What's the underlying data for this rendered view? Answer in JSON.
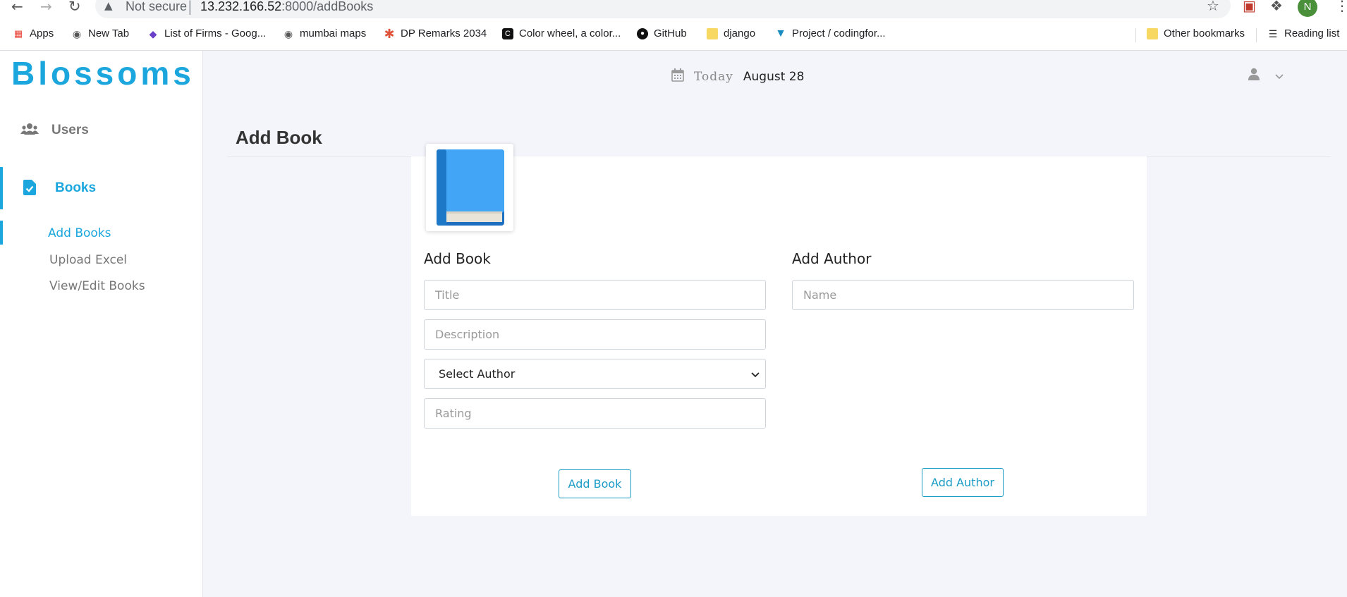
{
  "browser": {
    "security_label": "Not secure",
    "url_host": "13.232.166.52",
    "url_rest": ":8000/addBooks",
    "profile_initial": "N",
    "bookmarks": [
      {
        "label": "Apps",
        "icon": "apps-grid-icon"
      },
      {
        "label": "New Tab",
        "icon": "globe-icon"
      },
      {
        "label": "List of Firms - Goog...",
        "icon": "stack-icon"
      },
      {
        "label": "mumbai maps",
        "icon": "globe-icon"
      },
      {
        "label": "DP Remarks 2034",
        "icon": "asterisk-icon"
      },
      {
        "label": "Color wheel, a color...",
        "icon": "color-wheel-icon"
      },
      {
        "label": "GitHub",
        "icon": "github-icon"
      },
      {
        "label": "django",
        "icon": "folder-icon"
      },
      {
        "label": "Project / codingfor...",
        "icon": "fox-icon"
      }
    ],
    "other_bookmarks": "Other bookmarks",
    "reading_list": "Reading list"
  },
  "sidebar": {
    "brand": "Blossoms",
    "items": [
      {
        "label": "Users",
        "icon": "users-icon"
      },
      {
        "label": "Books",
        "icon": "file-check-icon"
      }
    ],
    "sub_items": [
      {
        "label": "Add Books"
      },
      {
        "label": "Upload Excel"
      },
      {
        "label": "View/Edit Books"
      }
    ]
  },
  "topbar": {
    "today_label": "Today",
    "date": "August 28"
  },
  "page": {
    "title": "Add Book",
    "book_form": {
      "heading": "Add Book",
      "title_placeholder": "Title",
      "description_placeholder": "Description",
      "author_select": "Select Author",
      "rating_placeholder": "Rating",
      "submit": "Add Book"
    },
    "author_form": {
      "heading": "Add Author",
      "name_placeholder": "Name",
      "submit": "Add Author"
    }
  },
  "colors": {
    "accent": "#1ba7dd",
    "button": "#1b9cc6",
    "main_bg": "#f4f4fb"
  }
}
